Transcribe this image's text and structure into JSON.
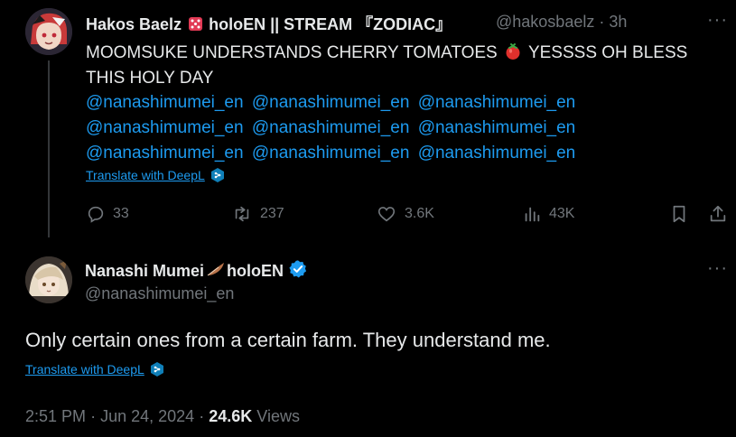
{
  "parent_tweet": {
    "display_name": "Hakos Baelz",
    "display_name_suffix": "holoEN || STREAM 『ZODIAC』",
    "handle": "@hakosbaelz",
    "time_separator": "·",
    "time": "3h",
    "text_part1": "MOOMSUKE UNDERSTANDS CHERRY TOMATOES",
    "text_part2": "YESSSS OH BLESS THIS HOLY DAY",
    "mentions": [
      "@nanashimumei_en",
      "@nanashimumei_en",
      "@nanashimumei_en",
      "@nanashimumei_en",
      "@nanashimumei_en",
      "@nanashimumei_en",
      "@nanashimumei_en",
      "@nanashimumei_en",
      "@nanashimumei_en"
    ],
    "translate_label": "Translate with DeepL",
    "stats": {
      "replies": "33",
      "reposts": "237",
      "likes": "3.6K",
      "views": "43K"
    },
    "more_label": "···"
  },
  "main_tweet": {
    "display_name": "Nanashi Mumei",
    "display_name_suffix": "holoEN",
    "handle": "@nanashimumei_en",
    "text": "Only certain ones from a certain farm. They understand me.",
    "translate_label": "Translate with DeepL",
    "time": "2:51 PM",
    "separator": "·",
    "date": "Jun 24, 2024",
    "views_count": "24.6K",
    "views_label": "Views",
    "more_label": "···"
  },
  "colors": {
    "background": "#000000",
    "text": "#e7e9ea",
    "muted": "#71767b",
    "link": "#1d9bf0",
    "divider": "#333639"
  },
  "icons": {
    "dice": "dice-icon",
    "tomato": "tomato-icon",
    "feather": "feather-icon",
    "verified": "verified-badge-icon",
    "deepl": "deepl-icon",
    "reply": "reply-icon",
    "repost": "repost-icon",
    "like": "heart-icon",
    "views": "views-icon",
    "bookmark": "bookmark-icon",
    "share": "share-icon"
  }
}
